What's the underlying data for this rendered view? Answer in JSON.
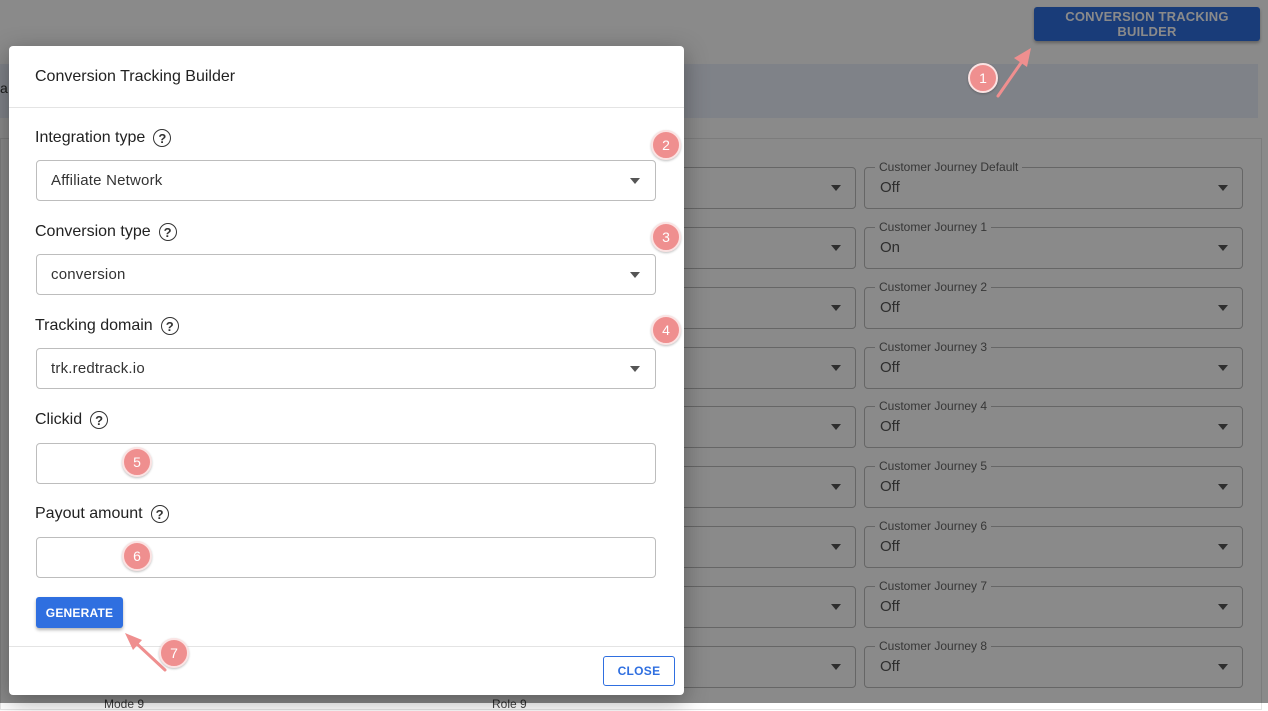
{
  "header": {
    "builder_button_label": "CONVERSION TRACKING BUILDER",
    "info_text": "a"
  },
  "background": {
    "journeys": [
      {
        "label": "Customer Journey Default",
        "value": "Off"
      },
      {
        "label": "Customer Journey 1",
        "value": "On"
      },
      {
        "label": "Customer Journey 2",
        "value": "Off"
      },
      {
        "label": "Customer Journey 3",
        "value": "Off"
      },
      {
        "label": "Customer Journey 4",
        "value": "Off"
      },
      {
        "label": "Customer Journey 5",
        "value": "Off"
      },
      {
        "label": "Customer Journey 6",
        "value": "Off"
      },
      {
        "label": "Customer Journey 7",
        "value": "Off"
      },
      {
        "label": "Customer Journey 8",
        "value": "Off"
      }
    ],
    "footer_left": "Mode 9",
    "footer_mid": "Role 9"
  },
  "modal": {
    "title": "Conversion Tracking Builder",
    "integration_type": {
      "label": "Integration type",
      "value": "Affiliate Network"
    },
    "conversion_type": {
      "label": "Conversion type",
      "value": "conversion"
    },
    "tracking_domain": {
      "label": "Tracking domain",
      "value": "trk.redtrack.io"
    },
    "clickid": {
      "label": "Clickid",
      "value": ""
    },
    "payout_amount": {
      "label": "Payout amount",
      "value": ""
    },
    "help_glyph": "?",
    "generate_label": "GENERATE",
    "close_label": "CLOSE"
  },
  "annotations": {
    "steps": [
      "1",
      "2",
      "3",
      "4",
      "5",
      "6",
      "7"
    ],
    "badge_color": "#ef8f8f",
    "arrow_color": "#ef8f8f"
  },
  "colors": {
    "accent": "#2f6fe0",
    "overlay": "rgba(0,0,0,0.46)"
  }
}
